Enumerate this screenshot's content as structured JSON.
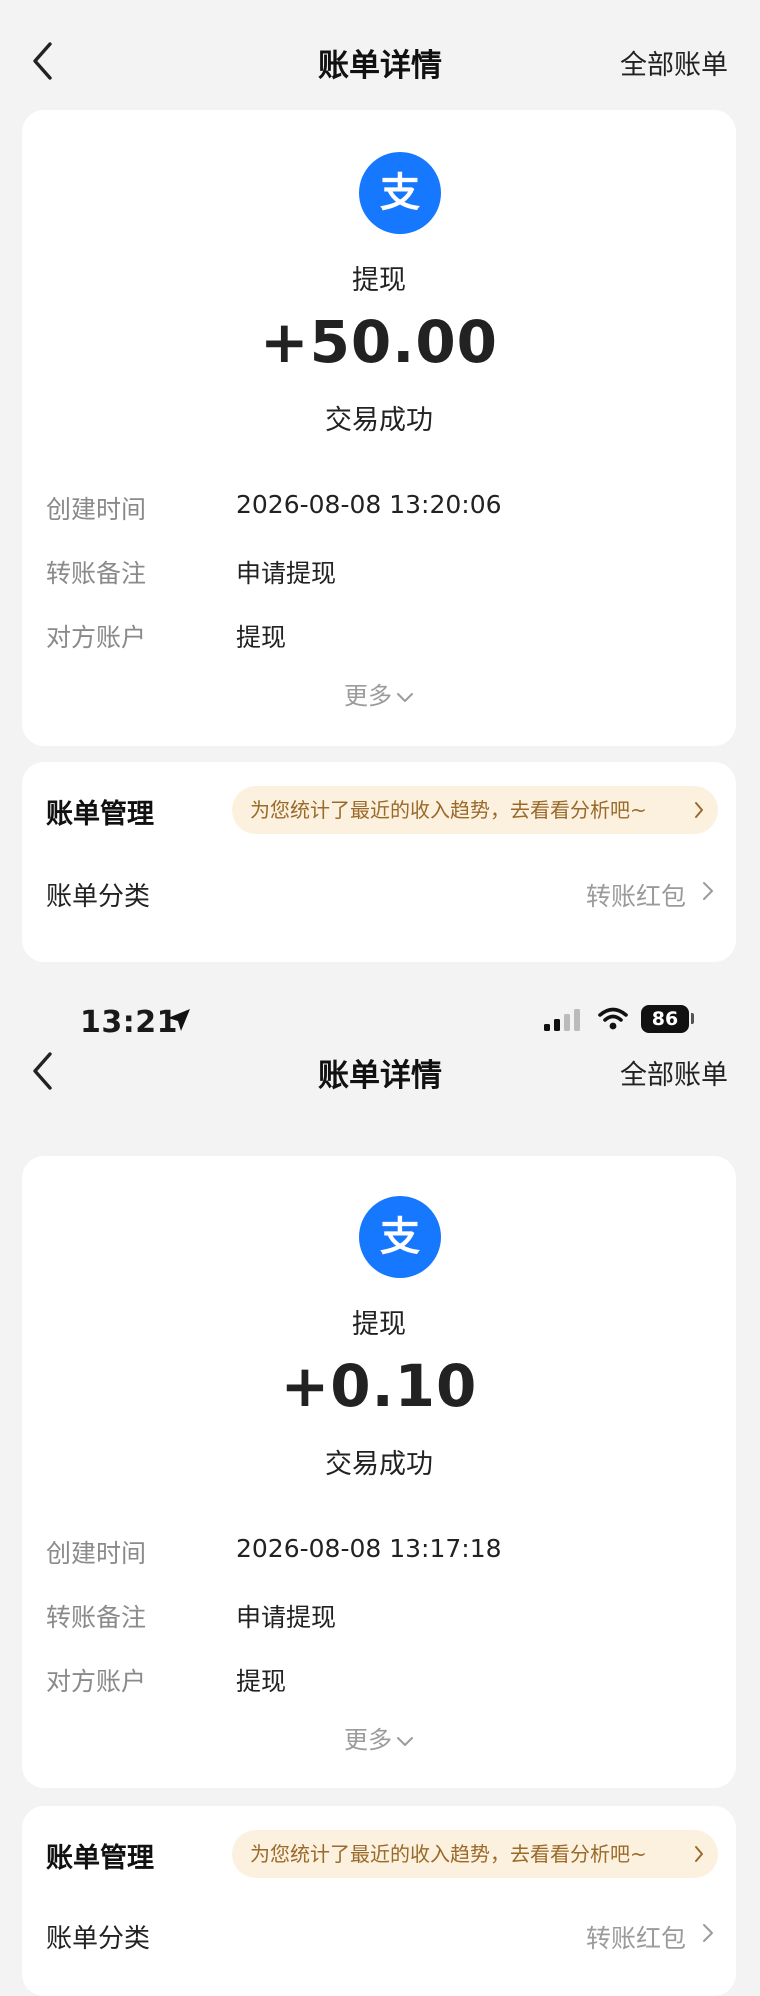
{
  "status_bar": {
    "time": "13:21",
    "battery": "86",
    "location_icon": "location-arrow-icon",
    "signal_icon": "cellular-signal-icon",
    "wifi_icon": "wifi-icon"
  },
  "screens": [
    {
      "nav": {
        "back_icon": "chevron-left-icon",
        "title": "账单详情",
        "right_link": "全部账单"
      },
      "summary": {
        "logo_icon": "alipay-logo-icon",
        "kind": "提现",
        "amount": "+50.00",
        "status": "交易成功"
      },
      "details": [
        {
          "label": "创建时间",
          "value": "2026-08-08 13:20:06"
        },
        {
          "label": "转账备注",
          "value": "申请提现"
        },
        {
          "label": "对方账户",
          "value": "提现"
        }
      ],
      "more_label": "更多",
      "management": {
        "title": "账单管理",
        "promo": "为您统计了最近的收入趋势，去看看分析吧~",
        "category_label": "账单分类",
        "category_value": "转账红包"
      }
    },
    {
      "nav": {
        "back_icon": "chevron-left-icon",
        "title": "账单详情",
        "right_link": "全部账单"
      },
      "summary": {
        "logo_icon": "alipay-logo-icon",
        "kind": "提现",
        "amount": "+0.10",
        "status": "交易成功"
      },
      "details": [
        {
          "label": "创建时间",
          "value": "2026-08-08 13:17:18"
        },
        {
          "label": "转账备注",
          "value": "申请提现"
        },
        {
          "label": "对方账户",
          "value": "提现"
        }
      ],
      "more_label": "更多",
      "management": {
        "title": "账单管理",
        "promo": "为您统计了最近的收入趋势，去看看分析吧~",
        "category_label": "账单分类",
        "category_value": "转账红包"
      }
    }
  ],
  "colors": {
    "background": "#f3f3f3",
    "card": "#ffffff",
    "alipay_blue": "#1677ff",
    "promo_bg": "#fcf1df",
    "promo_text": "#9a6a2a",
    "muted_text": "#8a8a8a"
  }
}
